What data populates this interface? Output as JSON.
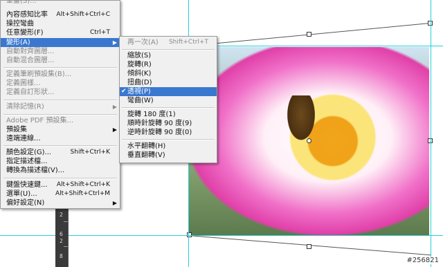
{
  "edit_menu": {
    "items": [
      {
        "label": "筆畫(S)...",
        "shortcut": "",
        "disabled": true,
        "submenu": false,
        "cut": true
      },
      {
        "label": "內容感知比率",
        "shortcut": "Alt+Shift+Ctrl+C",
        "disabled": false,
        "submenu": false
      },
      {
        "label": "操控彎曲",
        "shortcut": "",
        "disabled": false,
        "submenu": false
      },
      {
        "label": "任意變形(F)",
        "shortcut": "Ctrl+T",
        "disabled": false,
        "submenu": false
      },
      {
        "label": "變形(A)",
        "shortcut": "",
        "disabled": false,
        "submenu": true,
        "selected": true
      },
      {
        "label": "自動對齊圖層...",
        "shortcut": "",
        "disabled": true,
        "submenu": false
      },
      {
        "label": "自動混合圖層...",
        "shortcut": "",
        "disabled": true,
        "submenu": false
      },
      {
        "label": "定義筆刷預設集(B)...",
        "shortcut": "",
        "disabled": true,
        "submenu": false
      },
      {
        "label": "定義圖樣...",
        "shortcut": "",
        "disabled": true,
        "submenu": false
      },
      {
        "label": "定義自訂形狀...",
        "shortcut": "",
        "disabled": true,
        "submenu": false
      },
      {
        "label": "清除記憶(R)",
        "shortcut": "",
        "disabled": true,
        "submenu": true
      },
      {
        "label": "Adobe PDF 預設集...",
        "shortcut": "",
        "disabled": true,
        "submenu": false
      },
      {
        "label": "預設集",
        "shortcut": "",
        "disabled": false,
        "submenu": true
      },
      {
        "label": "遠端連線...",
        "shortcut": "",
        "disabled": false,
        "submenu": false
      },
      {
        "label": "顏色設定(G)...",
        "shortcut": "Shift+Ctrl+K",
        "disabled": false,
        "submenu": false
      },
      {
        "label": "指定描述檔...",
        "shortcut": "",
        "disabled": false,
        "submenu": false
      },
      {
        "label": "轉換為描述檔(V)...",
        "shortcut": "",
        "disabled": false,
        "submenu": false
      },
      {
        "label": "鍵盤快速鍵...",
        "shortcut": "Alt+Shift+Ctrl+K",
        "disabled": false,
        "submenu": false
      },
      {
        "label": "選單(U)...",
        "shortcut": "Alt+Shift+Ctrl+M",
        "disabled": false,
        "submenu": false
      },
      {
        "label": "偏好設定(N)",
        "shortcut": "",
        "disabled": false,
        "submenu": true
      }
    ]
  },
  "transform_submenu": {
    "items": [
      {
        "label": "再一次(A)",
        "shortcut": "Shift+Ctrl+T",
        "disabled": true
      },
      {
        "label": "縮放(S)",
        "shortcut": "",
        "disabled": false
      },
      {
        "label": "旋轉(R)",
        "shortcut": "",
        "disabled": false
      },
      {
        "label": "傾斜(K)",
        "shortcut": "",
        "disabled": false
      },
      {
        "label": "扭曲(D)",
        "shortcut": "",
        "disabled": false
      },
      {
        "label": "透視(P)",
        "shortcut": "",
        "disabled": false,
        "selected": true,
        "checked": true
      },
      {
        "label": "彎曲(W)",
        "shortcut": "",
        "disabled": false
      },
      {
        "label": "旋轉 180 度(1)",
        "shortcut": "",
        "disabled": false
      },
      {
        "label": "順時針旋轉 90 度(9)",
        "shortcut": "",
        "disabled": false
      },
      {
        "label": "逆時針旋轉 90 度(0)",
        "shortcut": "",
        "disabled": false
      },
      {
        "label": "水平翻轉(H)",
        "shortcut": "",
        "disabled": false
      },
      {
        "label": "垂直翻轉(V)",
        "shortcut": "",
        "disabled": false
      }
    ]
  },
  "ruler": {
    "numbers": [
      "2",
      "6",
      "2",
      "8"
    ]
  },
  "watermark": "#256821",
  "colors": {
    "guide": "#22d0d8",
    "menu_highlight": "#3a78d0",
    "menu_bg": "#f0f0f0"
  }
}
